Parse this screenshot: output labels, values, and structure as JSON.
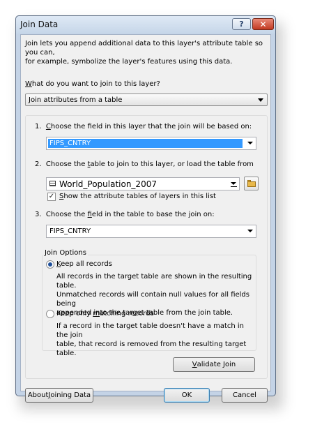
{
  "window": {
    "title": "Join Data",
    "help_label": "?",
    "close_label": "✕"
  },
  "intro": {
    "line1": "Join lets you append additional data to this layer's attribute table so you can,",
    "line2": "for example, symbolize the layer's features using this data."
  },
  "join_type": {
    "question_prefix": "",
    "question_key": "W",
    "question_rest": "hat do you want to join to this layer?",
    "selected": "Join attributes from a table"
  },
  "step1": {
    "num": "1.",
    "prefix": "",
    "key": "C",
    "rest": "hoose the field in this layer that the join will be based on:",
    "value": "FIPS_CNTRY"
  },
  "step2": {
    "num": "2.",
    "prefix": "Choose the ",
    "key": "t",
    "rest": "able to join to this layer, or load the table from",
    "value": "World_Population_2007",
    "table_icon": "table-icon",
    "browse_icon": "folder-icon"
  },
  "show_tables": {
    "checked": true,
    "key": "S",
    "rest": "how the attribute tables of layers in this list"
  },
  "step3": {
    "num": "3.",
    "prefix": "Choose the ",
    "key": "f",
    "rest": "ield in the table to base the join on:",
    "value": "FIPS_CNTRY"
  },
  "join_options": {
    "legend": "Join Options",
    "keep_all": {
      "key": "K",
      "rest": "eep all records",
      "selected": true,
      "desc1": "All records in the target table are shown in the resulting table.",
      "desc2": "Unmatched records will contain null values for all fields being",
      "desc3": "appended into the target table from the join table."
    },
    "keep_matching": {
      "prefix": "Keep only ",
      "key": "m",
      "rest": "atching records",
      "selected": false,
      "desc1": "If a record in the target table doesn't have a match in the join",
      "desc2": "table, that record is removed from the resulting target table."
    }
  },
  "buttons": {
    "validate_key": "V",
    "validate_rest": "alidate Join",
    "about_prefix": "About ",
    "about_key": "J",
    "about_rest": "oining Data",
    "ok": "OK",
    "cancel": "Cancel"
  }
}
